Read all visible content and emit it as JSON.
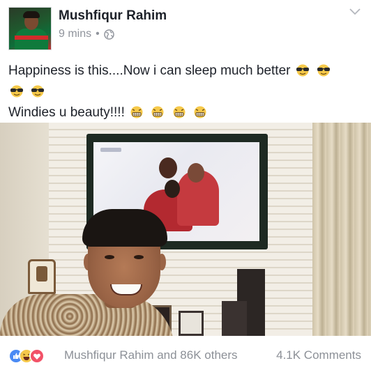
{
  "post": {
    "author": "Mushfiqur Rahim",
    "time": "9 mins",
    "separator": "•",
    "privacy_icon": "globe-icon",
    "menu_icon": "chevron-down-icon",
    "text_line1": "Happiness is this....Now i can sleep much better",
    "text_line3": "Windies u beauty!!!!",
    "emoji": {
      "line1": [
        "sunglasses-emoji",
        "sunglasses-emoji"
      ],
      "line2": [
        "sunglasses-emoji",
        "sunglasses-emoji"
      ],
      "line3": [
        "grimacing-emoji",
        "grimacing-emoji",
        "grimacing-emoji",
        "grimacing-emoji"
      ]
    },
    "photo": "selfie-in-front-of-tv"
  },
  "footer": {
    "reaction_icons": [
      "like-icon",
      "haha-icon",
      "love-icon"
    ],
    "reacted_by": "Mushfiqur Rahim and 86K others",
    "comments": "4.1K Comments"
  },
  "colors": {
    "name_text": "#1d2129",
    "meta_text": "#90949c",
    "like_blue": "#4a8af4",
    "haha_yellow": "#f6c94a",
    "love_red": "#f25268"
  }
}
